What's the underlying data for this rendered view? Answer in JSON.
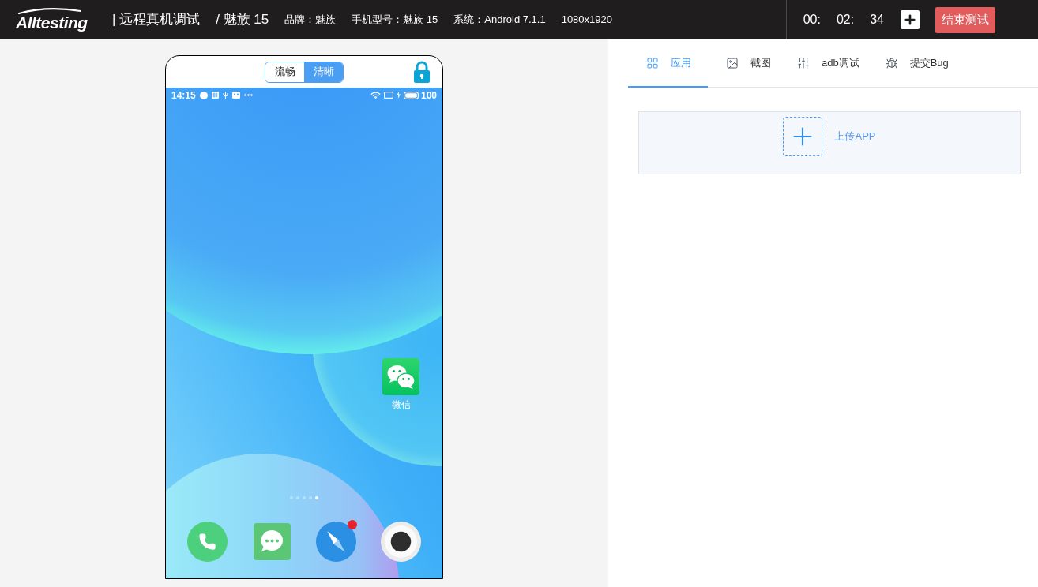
{
  "header": {
    "logo": "Alltesting",
    "title": "| 远程真机调试",
    "device": "/ 魅族 15",
    "specs": [
      "品牌：魅族",
      "手机型号：魅族 15",
      "系统：Android 7.1.1",
      "1080x1920"
    ],
    "timer": [
      "00:",
      "02:",
      "34"
    ],
    "end_button": "结束测试"
  },
  "phone": {
    "quality_options": [
      {
        "label": "流畅",
        "selected": false
      },
      {
        "label": "清晰",
        "selected": true
      }
    ],
    "status_bar": {
      "time": "14:15",
      "battery": "100"
    },
    "home_apps": [
      {
        "label": "微信"
      }
    ],
    "page_dots": [
      {
        "selected": false
      },
      {
        "selected": false
      },
      {
        "selected": false
      },
      {
        "selected": false
      },
      {
        "selected": true
      }
    ],
    "dock": [
      {
        "badge": false
      },
      {
        "badge": false
      },
      {
        "badge": true
      },
      {
        "badge": false
      }
    ]
  },
  "panel": {
    "tabs": [
      {
        "label": "应用",
        "selected": true
      },
      {
        "label": "截图",
        "selected": false
      },
      {
        "label": "adb调试",
        "selected": false
      },
      {
        "label": "提交Bug",
        "selected": false
      }
    ],
    "upload": {
      "label": "上传APP"
    }
  }
}
